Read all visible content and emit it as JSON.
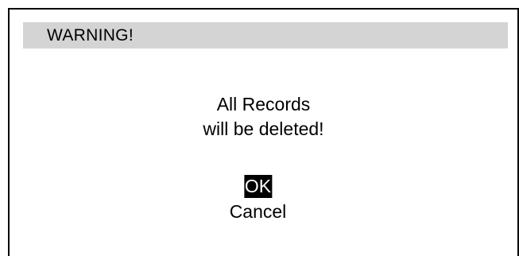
{
  "dialog": {
    "title": "WARNING!",
    "message_lines": [
      "All Records",
      "will be deleted!"
    ],
    "options": [
      {
        "label": "OK",
        "selected": true
      },
      {
        "label": "Cancel",
        "selected": false
      }
    ]
  },
  "colors": {
    "title_bar": "#d4d4d4",
    "border": "#000000",
    "selected_bg": "#000000",
    "selected_fg": "#ffffff"
  }
}
